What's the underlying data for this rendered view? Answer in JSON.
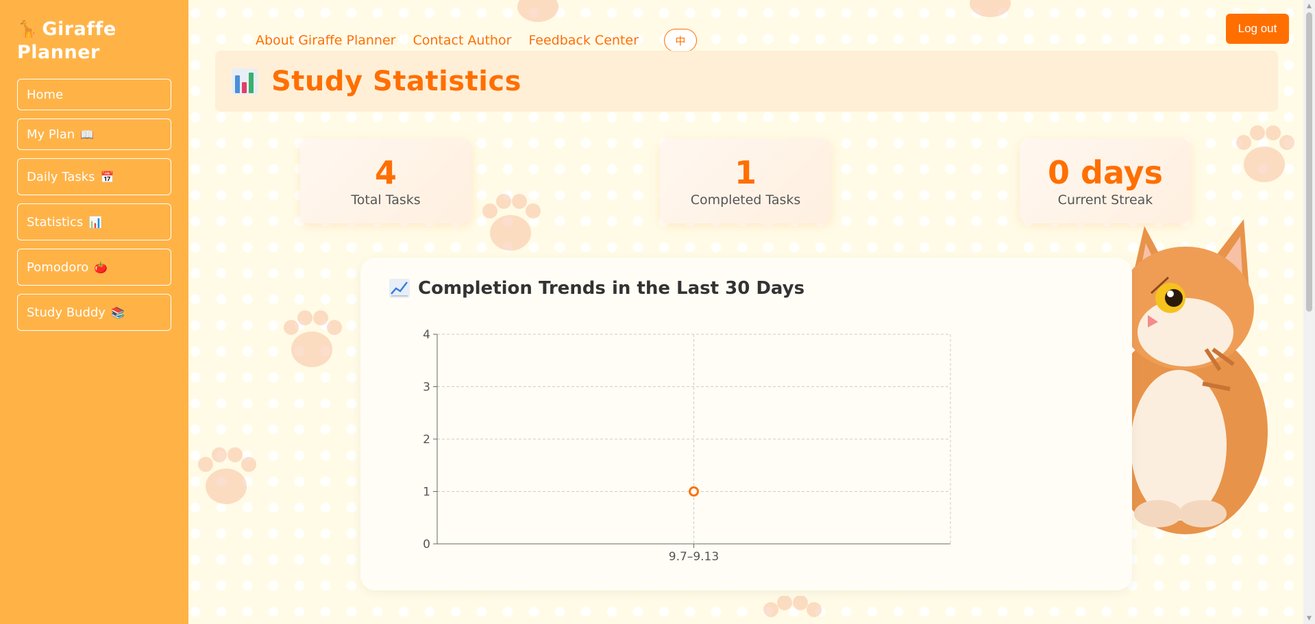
{
  "sidebar": {
    "brand": "Giraffe Planner",
    "items": [
      {
        "label": "Home",
        "emoji": ""
      },
      {
        "label": "My Plan",
        "emoji": "📖"
      },
      {
        "label": "Daily Tasks",
        "emoji": "📅"
      },
      {
        "label": "Statistics",
        "emoji": "📊"
      },
      {
        "label": "Pomodoro",
        "emoji": "🍅"
      },
      {
        "label": "Study Buddy",
        "emoji": "📚"
      }
    ]
  },
  "topnav": {
    "about": "About Giraffe Planner",
    "contact": "Contact Author",
    "feedback": "Feedback Center",
    "language": "中"
  },
  "logout_label": "Log out",
  "page": {
    "title": "Study Statistics"
  },
  "stats": {
    "total": {
      "value": "4",
      "label": "Total Tasks"
    },
    "completed": {
      "value": "1",
      "label": "Completed Tasks"
    },
    "streak": {
      "value": "0 days",
      "label": "Current Streak"
    }
  },
  "chart": {
    "title": "Completion Trends in the Last 30 Days"
  },
  "chart_data": {
    "type": "line",
    "title": "Completion Trends in the Last 30 Days",
    "categories": [
      "9.7–9.13"
    ],
    "series": [
      {
        "values": [
          1
        ]
      }
    ],
    "ylim": [
      0,
      4
    ],
    "yticks": [
      0,
      1,
      2,
      3,
      4
    ],
    "grid": true,
    "color": "#ff6f00"
  },
  "colors": {
    "accent": "#ff6f00",
    "sidebar": "#ffb347",
    "background": "#fffbe6"
  }
}
